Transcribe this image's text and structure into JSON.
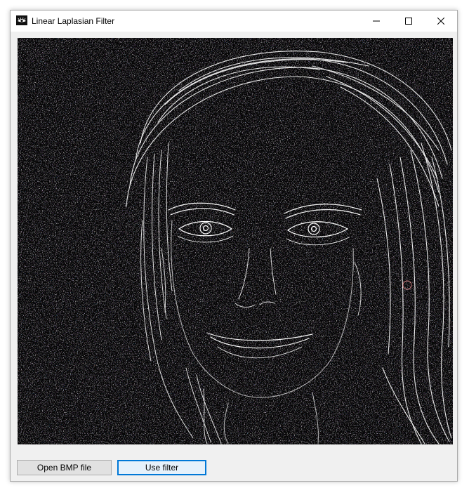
{
  "window": {
    "title": "Linear Laplasian Filter",
    "icons": {
      "app": "eye-icon",
      "minimize": "minimize-icon",
      "maximize": "maximize-icon",
      "close": "close-icon"
    }
  },
  "buttons": {
    "open_label": "Open BMP file",
    "filter_label": "Use filter"
  },
  "colors": {
    "canvas_background": "#050505",
    "edge_lines": "#ffffff",
    "focus_border": "#0078d7"
  }
}
